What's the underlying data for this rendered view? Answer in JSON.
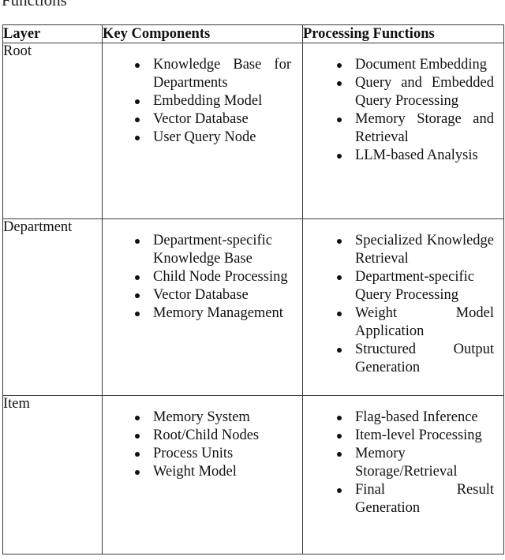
{
  "caption": "Functions",
  "table": {
    "headers": [
      "Layer",
      "Key Components",
      "Processing Functions"
    ],
    "rows": [
      {
        "layer": "Root",
        "key_components": [
          "Knowledge Base for Departments",
          "Embedding Model",
          "Vector Database",
          "User Query Node"
        ],
        "processing_functions": [
          "Document Embedding",
          "Query and Embedded Query Processing",
          "Memory Storage and Retrieval",
          "LLM-based Analysis"
        ]
      },
      {
        "layer": "Department",
        "key_components": [
          "Department-specific Knowledge Base",
          "Child Node Processing",
          "Vector Database",
          "Memory Management"
        ],
        "processing_functions": [
          "Specialized Knowledge Retrieval",
          "Department-specific Query Processing",
          "Weight Model Application",
          "Structured Output Generation"
        ]
      },
      {
        "layer": "Item",
        "key_components": [
          "Memory System",
          "Root/Child Nodes",
          "Process Units",
          "Weight Model"
        ],
        "processing_functions": [
          "Flag-based Inference",
          "Item-level Processing",
          "Memory Storage/Retrieval",
          "Final Result Generation"
        ]
      }
    ]
  }
}
